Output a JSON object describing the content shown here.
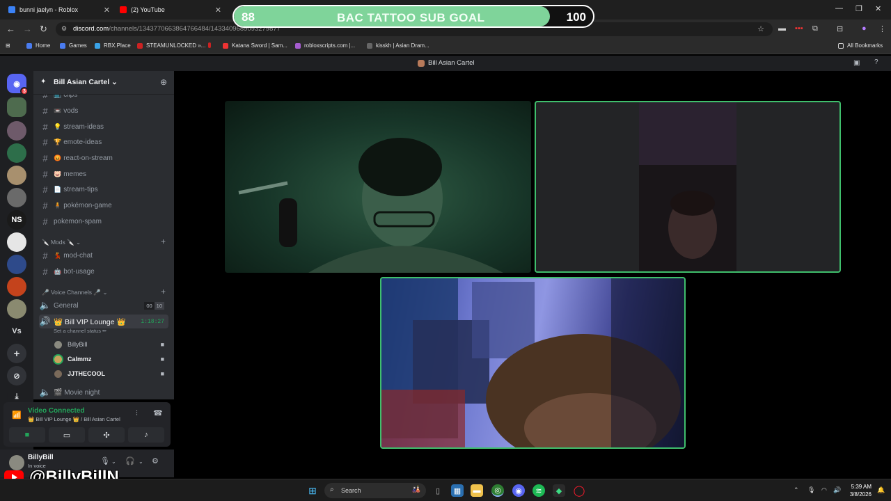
{
  "browser": {
    "tabs": [
      {
        "label": "bunni jaelyn - Roblox"
      },
      {
        "label": "(2) YouTube"
      }
    ],
    "url_domain": "discord.com",
    "url_path": "/channels/1343770663864766484/1433409689093279877",
    "bookmarks": [
      "Home",
      "Games",
      "RBX.Place",
      "STEAMUNLOCKED »...",
      "Katana Sword | Sam...",
      "robloxscripts.com |...",
      "kisskh | Asian Dram..."
    ],
    "all_bookmarks": "All Bookmarks"
  },
  "overlay": {
    "goal_current": "88",
    "goal_title": "BAC TATTOO SUB GOAL",
    "goal_target": "100",
    "goal_progress": 0.88,
    "youtube_handle": "@BillyBillN"
  },
  "discord": {
    "window_title": "Bill Asian Cartel",
    "server_name": "Bill Asian Cartel",
    "rail_badge": "3",
    "rail_vs": "Vs",
    "rail_ns": "NS",
    "channels": [
      {
        "emoji": "📺",
        "name": "clips"
      },
      {
        "emoji": "📼",
        "name": "vods"
      },
      {
        "emoji": "💡",
        "name": "stream-ideas"
      },
      {
        "emoji": "🏆",
        "name": "emote-ideas"
      },
      {
        "emoji": "😡",
        "name": "react-on-stream"
      },
      {
        "emoji": "🐷",
        "name": "memes"
      },
      {
        "emoji": "📄",
        "name": "stream-tips"
      },
      {
        "emoji": "🧍",
        "name": "pokémon-game"
      },
      {
        "emoji": "",
        "name": "pokemon-spam"
      }
    ],
    "mods_category": "🔪 Mods 🔪",
    "mod_channels": [
      {
        "emoji": "💃",
        "name": "mod-chat"
      },
      {
        "emoji": "🤖",
        "name": "bot-usage"
      }
    ],
    "voice_category": "🎤 Voice Channels 🎤",
    "voice_general": {
      "name": "General",
      "count_a": "00",
      "count_b": "10"
    },
    "voice_vip": {
      "name": "👑 Bill VIP Lounge 👑",
      "time": "1:18:27",
      "status": "Set a channel status ✏"
    },
    "voice_users": [
      {
        "name": "BillyBill",
        "speaking": false
      },
      {
        "name": "Calmmz",
        "speaking": true
      },
      {
        "name": "JJTHECOOL",
        "speaking": false
      }
    ],
    "voice_movie": "🎬 Movie night",
    "voice_panel": {
      "status": "Video Connected",
      "location": "👑 Bill VIP Lounge 👑 / Bill Asian Cartel"
    },
    "user": {
      "name": "BillyBill",
      "status": "In voice"
    }
  },
  "taskbar": {
    "search_label": "Search",
    "time": "5:39 AM",
    "date": "3/8/2026"
  },
  "colors": {
    "goal_fill": "#7fd49a",
    "speaking_border": "#3fbf6c",
    "discord_green": "#23a55a"
  }
}
